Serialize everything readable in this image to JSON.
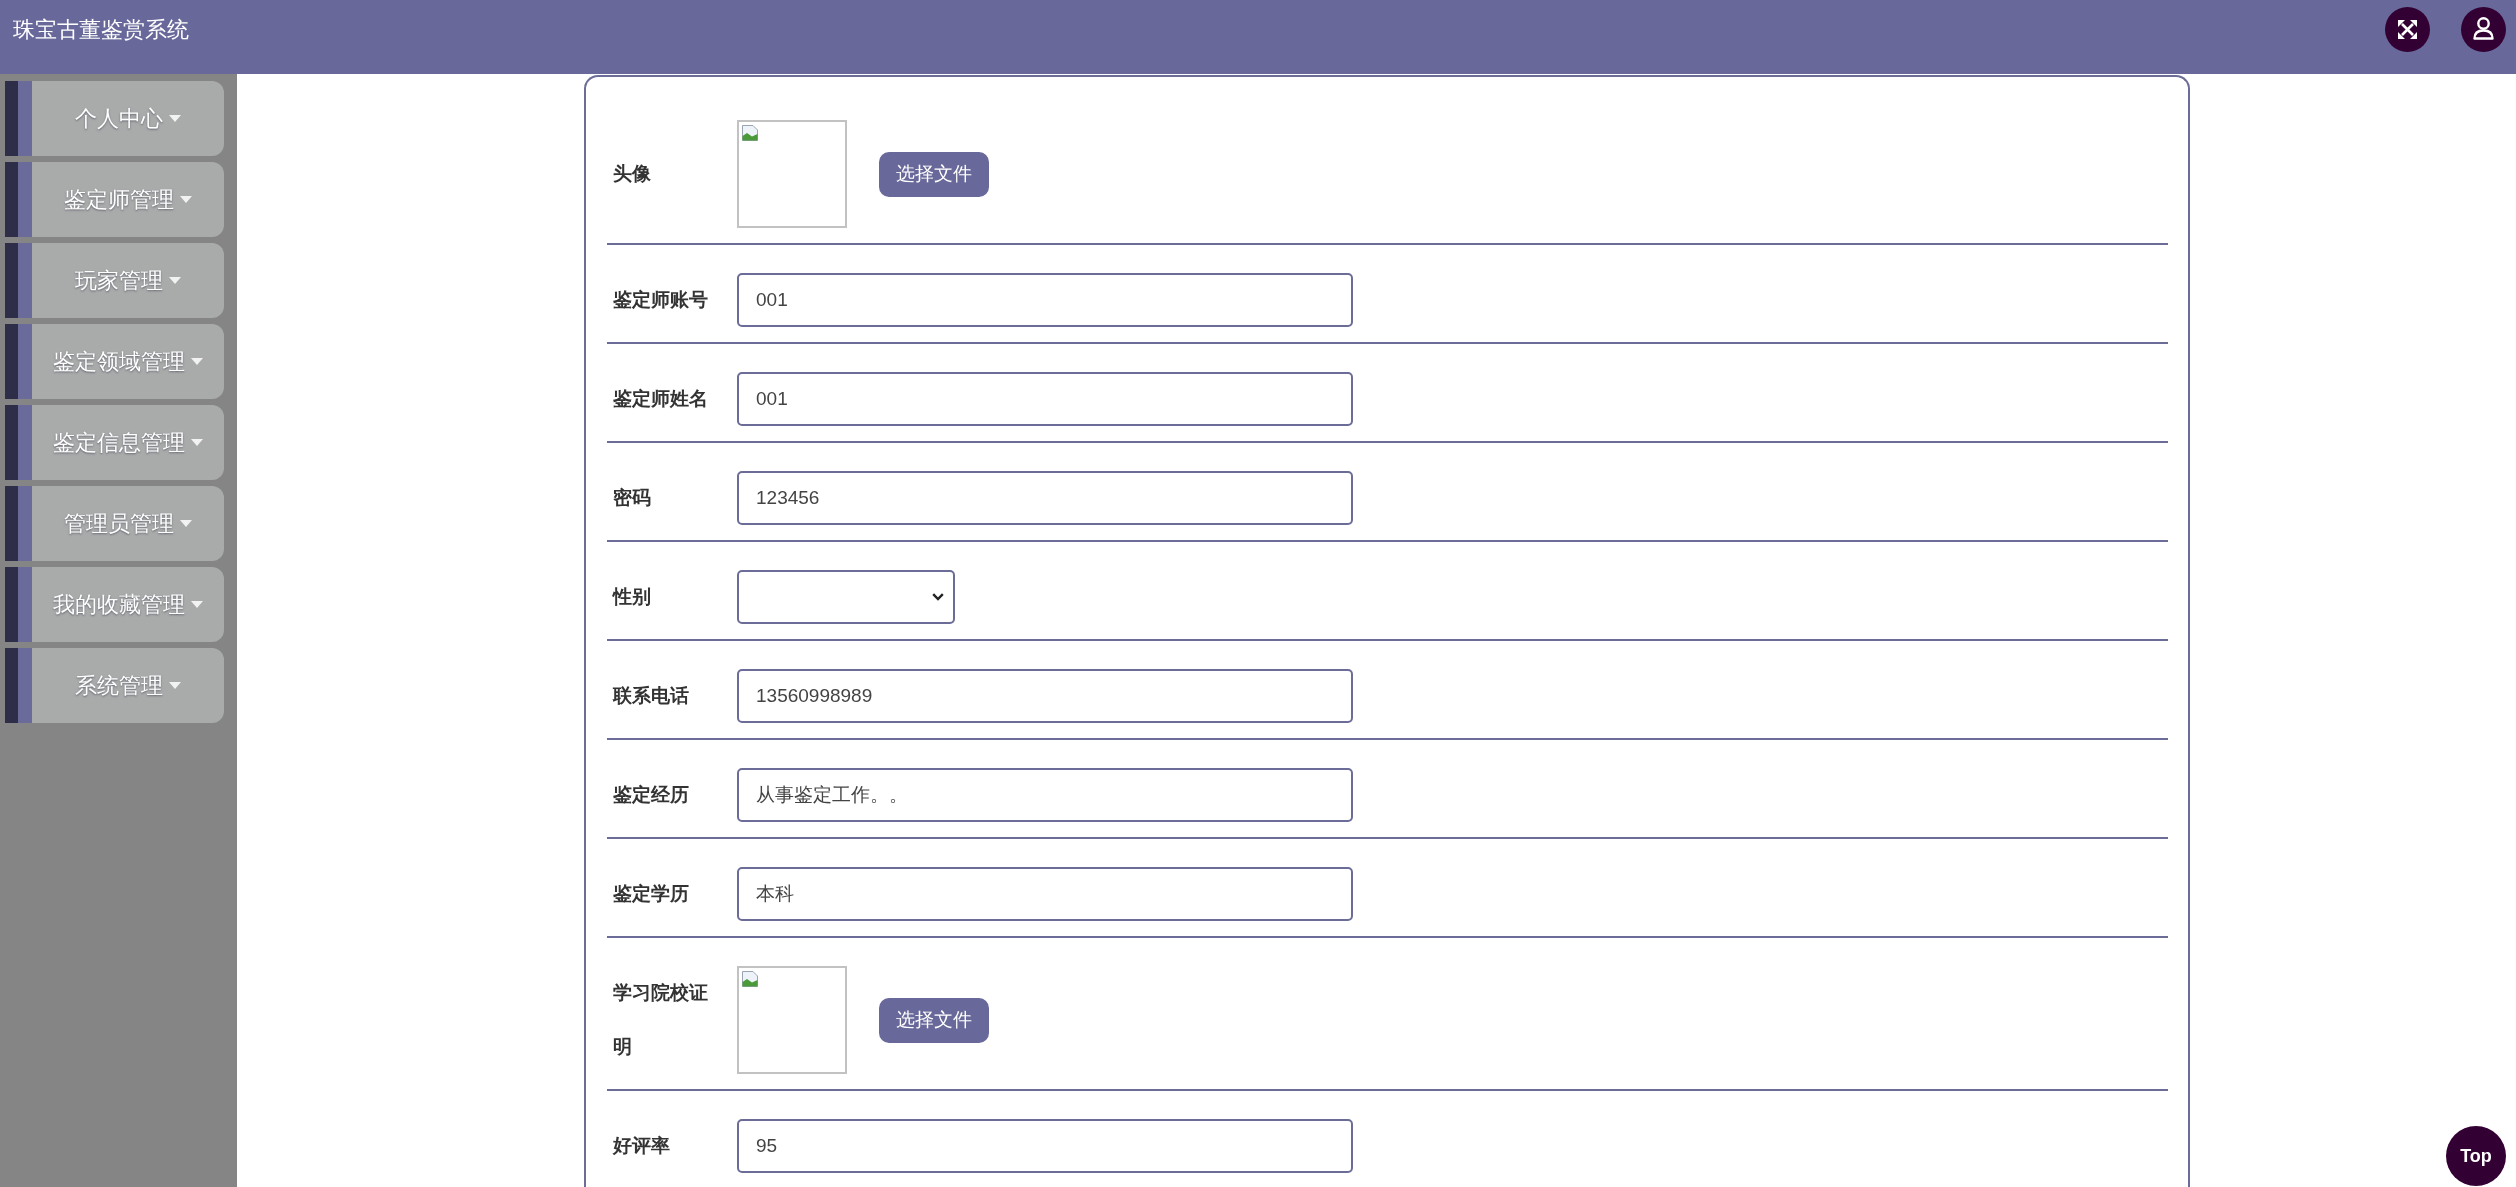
{
  "header": {
    "title": "珠宝古董鉴赏系统"
  },
  "sidebar": {
    "items": [
      {
        "label": "个人中心"
      },
      {
        "label": "鉴定师管理"
      },
      {
        "label": "玩家管理"
      },
      {
        "label": "鉴定领域管理"
      },
      {
        "label": "鉴定信息管理"
      },
      {
        "label": "管理员管理"
      },
      {
        "label": "我的收藏管理"
      },
      {
        "label": "系统管理"
      }
    ]
  },
  "form": {
    "fields": [
      {
        "kind": "image",
        "label": "头像",
        "button": "选择文件"
      },
      {
        "kind": "text",
        "label": "鉴定师账号",
        "value": "001"
      },
      {
        "kind": "text",
        "label": "鉴定师姓名",
        "value": "001"
      },
      {
        "kind": "text",
        "label": "密码",
        "value": "123456"
      },
      {
        "kind": "select",
        "label": "性别"
      },
      {
        "kind": "text",
        "label": "联系电话",
        "value": "13560998989"
      },
      {
        "kind": "text",
        "label": "鉴定经历",
        "value": "从事鉴定工作。。"
      },
      {
        "kind": "text",
        "label": "鉴定学历",
        "value": "本科"
      },
      {
        "kind": "image",
        "label": "学习院校证明",
        "button": "选择文件"
      },
      {
        "kind": "text",
        "label": "好评率",
        "value": "95"
      }
    ]
  },
  "back_to_top": "Top"
}
